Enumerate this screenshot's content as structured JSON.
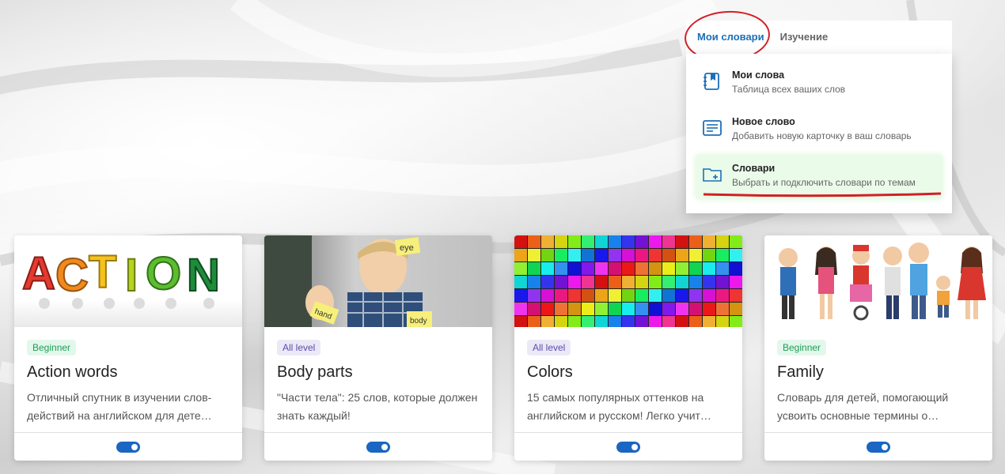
{
  "menu": {
    "tabs": [
      {
        "label": "Мои словари",
        "active": true
      },
      {
        "label": "Изучение",
        "active": false
      }
    ],
    "items": [
      {
        "title": "Мои слова",
        "subtitle": "Таблица всех ваших слов",
        "icon": "bookmark-notebook-icon"
      },
      {
        "title": "Новое слово",
        "subtitle": "Добавить новую карточку в ваш словарь",
        "icon": "list-card-icon"
      },
      {
        "title": "Словари",
        "subtitle": "Выбрать и подключить словари по темам",
        "icon": "folder-add-icon"
      }
    ]
  },
  "cards": [
    {
      "level": "Beginner",
      "title": "Action words",
      "description": "Отличный спутник в изучении слов-действий на английском для дете…",
      "image_text": "ACTION",
      "enabled": true
    },
    {
      "level": "All level",
      "title": "Body parts",
      "description": "\"Части тела\": 25 слов, которые должен знать каждый!",
      "image_text": [
        "eye",
        "hand",
        "body"
      ],
      "enabled": true
    },
    {
      "level": "All level",
      "title": "Colors",
      "description": "15 самых популярных оттенков на английском и русском! Легко учит…",
      "enabled": true
    },
    {
      "level": "Beginner",
      "title": "Family",
      "description": "Словарь для детей, помогающий усвоить основные термины о…",
      "enabled": true
    }
  ],
  "colors": {
    "accent": "#1d6fb8",
    "toggle": "#1a66c2",
    "highlight": "#d21f26",
    "beginner_badge": "#1f9d55",
    "all_level_badge": "#5b4bb0"
  }
}
